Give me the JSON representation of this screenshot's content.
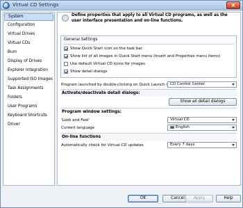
{
  "window": {
    "title": "Virtual CD Settings",
    "close_glyph": "×"
  },
  "sidebar": {
    "items": [
      {
        "label": "System"
      },
      {
        "label": "Configuration"
      },
      {
        "label": "Virtual Drives"
      },
      {
        "label": "Virtual CDs"
      },
      {
        "label": "Burn"
      },
      {
        "label": "Display of Drives"
      },
      {
        "label": "Explorer Integration"
      },
      {
        "label": "Supported ISO Images"
      },
      {
        "label": "Task Assignments"
      },
      {
        "label": "Folders"
      },
      {
        "label": "User Programs"
      },
      {
        "label": "Keyboard Shortcuts"
      },
      {
        "label": "Driver"
      }
    ],
    "selected": "System"
  },
  "content": {
    "intro": "Define properties that apply to all Virtual CD programs, as well as the user interface presentation and on-line functions.",
    "general_settings": {
      "title": "General Settings",
      "options": [
        {
          "label": "Show Quick Start icon on the task bar",
          "checked": true
        },
        {
          "label": "Show list of all images in Quick Start menu (Insert and Properties menu items)",
          "checked": true
        },
        {
          "label": "Use default Virtual CD icons for images",
          "checked": false
        },
        {
          "label": "Show detail dialogs",
          "checked": true
        }
      ]
    },
    "quick_launch": {
      "label": "Program launched by double-clicking on Quick Launch icon",
      "value": "CD Control Center"
    },
    "detail_dialogs": {
      "heading": "Activate/deactivate detail dialogs:",
      "button_label": "Show all detail dialogs"
    },
    "window_settings": {
      "heading": "Program window settings:",
      "look_label": "'Look and Feel'",
      "look_value": "Virtual CD",
      "language_label": "Current language",
      "language_value": "English"
    },
    "online": {
      "heading": "On-line functions",
      "update_label": "Automatically check for Virtual CD updates",
      "update_value": "Every 7 days"
    }
  },
  "buttons": {
    "ok": "OK",
    "cancel": "Cancel",
    "apply": "Apply",
    "help": "Help"
  },
  "icons": {
    "app": "virtual-cd-disc-icon",
    "info": "info-icon",
    "flag": "uk-flag-icon",
    "dropdown": "chevron-down-icon"
  }
}
